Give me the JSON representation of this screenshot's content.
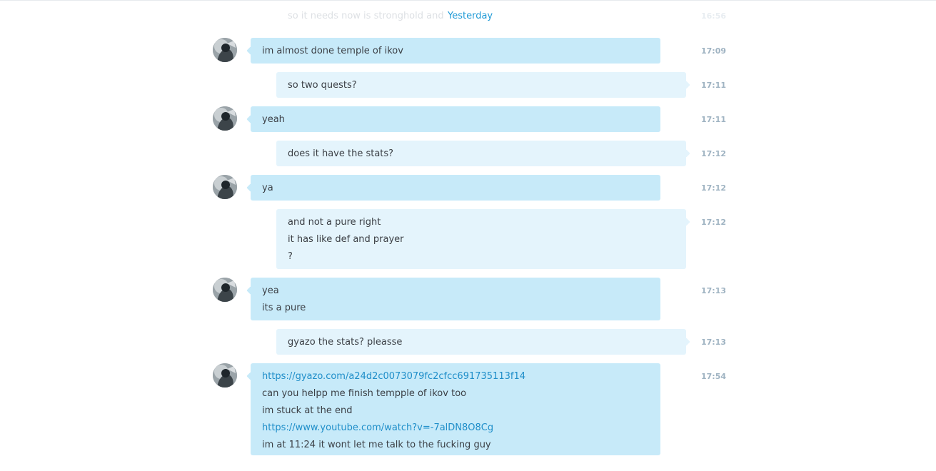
{
  "divider": {
    "faded_text": "so it needs now is stronghold and dt",
    "date_label": "Yesterday",
    "faded_time": "16:56"
  },
  "messages": [
    {
      "from": "contact",
      "lines": [
        "im almost done temple of ikov"
      ],
      "time": "17:09"
    },
    {
      "from": "me",
      "lines": [
        "so two quests?"
      ],
      "time": "17:11"
    },
    {
      "from": "contact",
      "lines": [
        "yeah"
      ],
      "time": "17:11"
    },
    {
      "from": "me",
      "lines": [
        "does it have the stats?"
      ],
      "time": "17:12"
    },
    {
      "from": "contact",
      "lines": [
        "ya"
      ],
      "time": "17:12"
    },
    {
      "from": "me",
      "lines": [
        "and not a pure right",
        "it has like def and prayer",
        "?"
      ],
      "time": "17:12"
    },
    {
      "from": "contact",
      "lines": [
        "yea",
        "its a pure"
      ],
      "time": "17:13"
    },
    {
      "from": "me",
      "lines": [
        "gyazo the stats? pleasse"
      ],
      "time": "17:13"
    },
    {
      "from": "contact",
      "lines": [
        "https://gyazo.com/a24d2c0073079fc2cfcc691735113f14",
        "can you helpp me finish tempple of ikov too",
        "im stuck at the end",
        "https://www.youtube.com/watch?v=-7alDN8O8Cg",
        "im at 11:24 it wont let me talk to the fucking guy"
      ],
      "time": "17:54"
    }
  ],
  "colors": {
    "incoming_bubble": "#c7eaf9",
    "outgoing_bubble": "#e4f4fc",
    "link": "#1f8ec9",
    "timestamp": "#9fb3c2",
    "date_label": "#1f9ad6"
  },
  "icons": {
    "avatar": "contact-avatar"
  }
}
